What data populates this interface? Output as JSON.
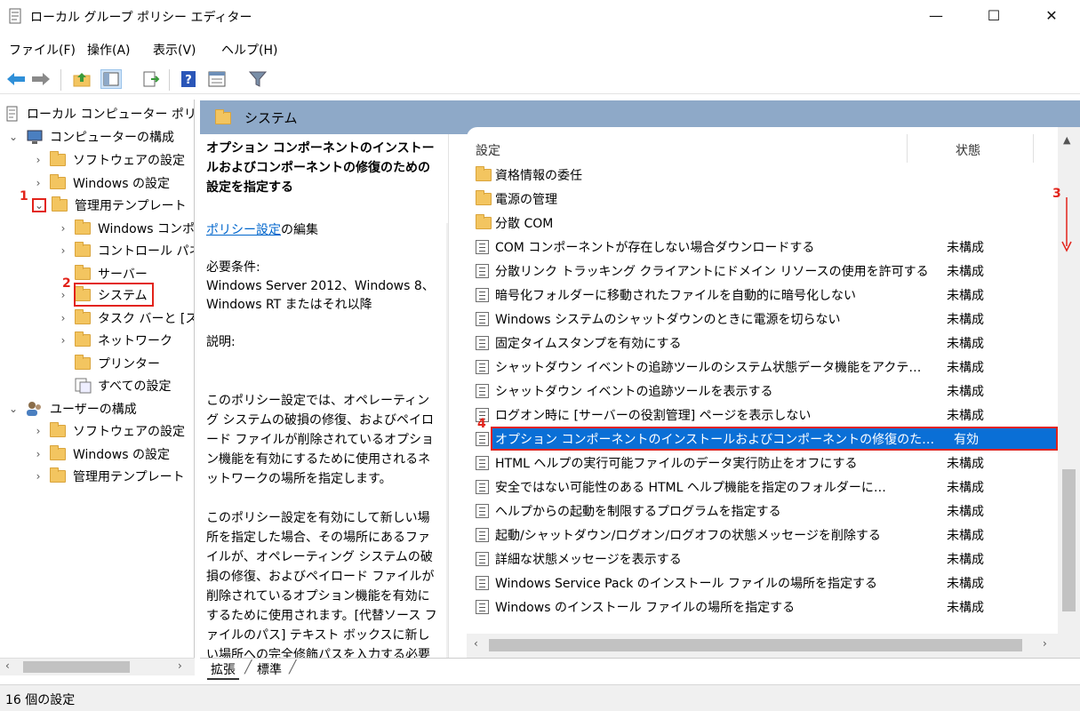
{
  "window": {
    "title": "ローカル グループ ポリシー エディター",
    "controls": {
      "minimize": "—",
      "maximize": "☐",
      "close": "✕"
    }
  },
  "menu": [
    "ファイル(F)",
    "操作(A)",
    "表示(V)",
    "ヘルプ(H)"
  ],
  "toolbar": {
    "icons": [
      "back-icon",
      "forward-icon",
      "up-folder-icon",
      "show-tree-icon",
      "export-icon",
      "help-icon",
      "properties-icon",
      "filter-icon"
    ]
  },
  "tree": {
    "root": "ローカル コンピューター ポリシー",
    "items": [
      {
        "label": "コンピューターの構成"
      },
      {
        "label": "ソフトウェアの設定"
      },
      {
        "label": "Windows の設定"
      },
      {
        "label": "管理用テンプレート"
      },
      {
        "label": "Windows コンポーネント"
      },
      {
        "label": "コントロール パネル"
      },
      {
        "label": "サーバー"
      },
      {
        "label": "システム"
      },
      {
        "label": "タスク バーと [スタート] メニュー"
      },
      {
        "label": "ネットワーク"
      },
      {
        "label": "プリンター"
      },
      {
        "label": "すべての設定"
      },
      {
        "label": "ユーザーの構成"
      },
      {
        "label": "ソフトウェアの設定"
      },
      {
        "label": "Windows の設定"
      },
      {
        "label": "管理用テンプレート"
      }
    ]
  },
  "header": {
    "folder_name": "システム"
  },
  "description": {
    "title": "オプション コンポーネントのインストールおよびコンポーネントの修復のための設定を指定する",
    "edit_link": "ポリシー設定",
    "edit_suffix": "の編集",
    "requirements_label": "必要条件:",
    "requirements": "Windows Server 2012、Windows 8、Windows RT またはそれ以降",
    "explanation_label": "説明:",
    "para1": "このポリシー設定では、オペレーティング システムの破損の修復、およびペイロード ファイルが削除されているオプション機能を有効にするために使用されるネットワークの場所を指定します。",
    "para2": "このポリシー設定を有効にして新しい場所を指定した場合、その場所にあるファイルが、オペレーティング システムの破損の修復、およびペイロード ファイルが削除されているオプション機能を有効にするために使用されます。[代替ソース ファイルのパス] テキスト ボックスに新しい場所への完全修飾パスを入力する必要が"
  },
  "list": {
    "col_setting": "設定",
    "col_state": "状態",
    "folders": [
      "資格情報の委任",
      "電源の管理",
      "分散 COM"
    ],
    "policies": [
      {
        "name": "COM コンポーネントが存在しない場合ダウンロードする",
        "state": "未構成"
      },
      {
        "name": "分散リンク トラッキング クライアントにドメイン リソースの使用を許可する",
        "state": "未構成"
      },
      {
        "name": "暗号化フォルダーに移動されたファイルを自動的に暗号化しない",
        "state": "未構成"
      },
      {
        "name": "Windows システムのシャットダウンのときに電源を切らない",
        "state": "未構成"
      },
      {
        "name": "固定タイムスタンプを有効にする",
        "state": "未構成"
      },
      {
        "name": "シャットダウン イベントの追跡ツールのシステム状態データ機能をアクテ…",
        "state": "未構成"
      },
      {
        "name": "シャットダウン イベントの追跡ツールを表示する",
        "state": "未構成"
      },
      {
        "name": "ログオン時に [サーバーの役割管理] ページを表示しない",
        "state": "未構成"
      },
      {
        "name": "オプション コンポーネントのインストールおよびコンポーネントの修復のた…",
        "state": "有効"
      },
      {
        "name": "HTML ヘルプの実行可能ファイルのデータ実行防止をオフにする",
        "state": "未構成"
      },
      {
        "name": "安全ではない可能性のある HTML ヘルプ機能を指定のフォルダーに…",
        "state": "未構成"
      },
      {
        "name": "ヘルプからの起動を制限するプログラムを指定する",
        "state": "未構成"
      },
      {
        "name": "起動/シャットダウン/ログオン/ログオフの状態メッセージを削除する",
        "state": "未構成"
      },
      {
        "name": "詳細な状態メッセージを表示する",
        "state": "未構成"
      },
      {
        "name": "Windows Service Pack のインストール ファイルの場所を指定する",
        "state": "未構成"
      },
      {
        "name": "Windows のインストール ファイルの場所を指定する",
        "state": "未構成"
      }
    ]
  },
  "tabs": [
    "拡張",
    "標準"
  ],
  "status": "16 個の設定",
  "annotations": {
    "n1": "1",
    "n2": "2",
    "n3": "3",
    "n4": "4"
  }
}
